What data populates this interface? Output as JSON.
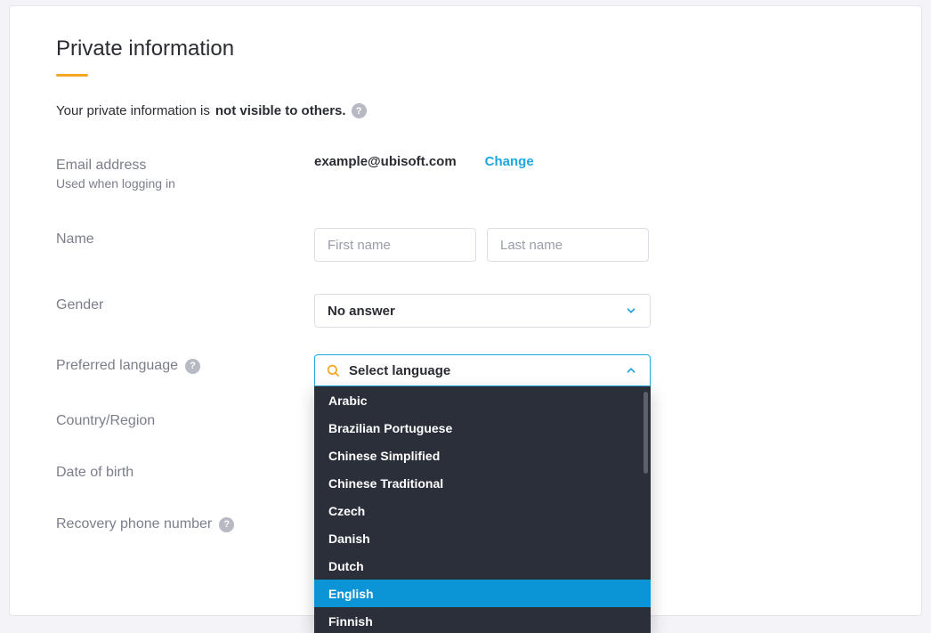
{
  "section": {
    "title": "Private information",
    "subtext_prefix": "Your private information is ",
    "subtext_bold": "not visible to others."
  },
  "email": {
    "label": "Email address",
    "sublabel": "Used when logging in",
    "value": "example@ubisoft.com",
    "change_link": "Change"
  },
  "name": {
    "label": "Name",
    "first_placeholder": "First name",
    "last_placeholder": "Last name"
  },
  "gender": {
    "label": "Gender",
    "selected": "No answer"
  },
  "language": {
    "label": "Preferred language",
    "search_placeholder": "Select language",
    "options": [
      "Arabic",
      "Brazilian Portuguese",
      "Chinese Simplified",
      "Chinese Traditional",
      "Czech",
      "Danish",
      "Dutch",
      "English",
      "Finnish"
    ],
    "selected_index": 7
  },
  "country": {
    "label": "Country/Region"
  },
  "dob": {
    "label": "Date of birth"
  },
  "recovery": {
    "label": "Recovery phone number"
  }
}
